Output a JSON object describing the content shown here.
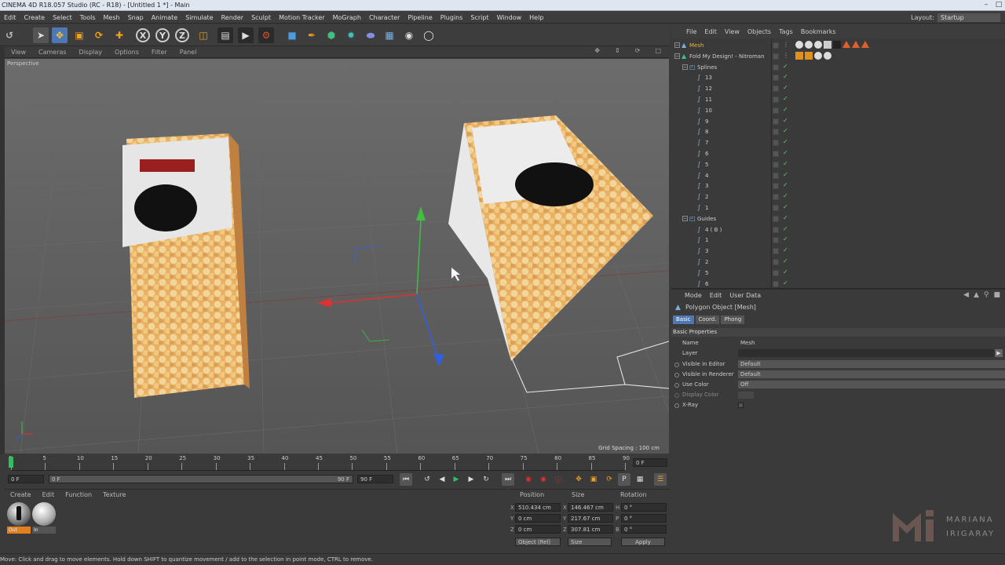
{
  "window": {
    "title": "CINEMA 4D R18.057 Studio (RC - R18) - [Untitled 1 *] - Main"
  },
  "menu": {
    "items": [
      "Edit",
      "Create",
      "Select",
      "Tools",
      "Mesh",
      "Snap",
      "Animate",
      "Simulate",
      "Render",
      "Sculpt",
      "Motion Tracker",
      "MoGraph",
      "Character",
      "Pipeline",
      "Plugins",
      "Script",
      "Window",
      "Help"
    ]
  },
  "layout": {
    "label": "Layout:",
    "value": "Startup"
  },
  "viewport": {
    "menu": [
      "View",
      "Cameras",
      "Display",
      "Options",
      "Filter",
      "Panel"
    ],
    "label": "Perspective",
    "grid_spacing": "Grid Spacing : 100 cm"
  },
  "toolbar": {
    "icons": [
      "undo-icon",
      "select-icon",
      "move-icon",
      "scale-icon",
      "rotate-icon",
      "add-icon",
      "x-axis-icon",
      "y-axis-icon",
      "z-axis-icon",
      "coordinate-system-icon",
      "render-view-icon",
      "render-picture-viewer-icon",
      "render-settings-icon",
      "cube-icon",
      "pen-icon",
      "subdivision-icon",
      "cloner-icon",
      "deformer-icon",
      "floor-icon",
      "camera-icon",
      "light-icon"
    ],
    "x_label": "X",
    "y_label": "Y",
    "z_label": "Z"
  },
  "timeline": {
    "ticks": [
      "0",
      "5",
      "10",
      "15",
      "20",
      "25",
      "30",
      "35",
      "40",
      "45",
      "50",
      "55",
      "60",
      "65",
      "70",
      "75",
      "80",
      "85",
      "90"
    ],
    "current_frame_display": "0 F",
    "current": 0,
    "max": 90,
    "start_frame": "0 F",
    "slider_left": "0 F",
    "slider_right": "90 F",
    "end_frame": "90 F"
  },
  "materials": {
    "menu": [
      "Create",
      "Edit",
      "Function",
      "Texture"
    ],
    "items": [
      {
        "label": "Out"
      },
      {
        "label": "In"
      }
    ]
  },
  "coordinates": {
    "headers": [
      "Position",
      "Size",
      "Rotation"
    ],
    "rows": [
      {
        "axis": "X",
        "pos": "510.434 cm",
        "size_axis": "X",
        "size": "146.467 cm",
        "rot_axis": "H",
        "rot": "0 °"
      },
      {
        "axis": "Y",
        "pos": "0 cm",
        "size_axis": "Y",
        "size": "217.67 cm",
        "rot_axis": "P",
        "rot": "0 °"
      },
      {
        "axis": "Z",
        "pos": "0 cm",
        "size_axis": "Z",
        "size": "307.81 cm",
        "rot_axis": "B",
        "rot": "0 °"
      }
    ],
    "mode": "Object (Rel)",
    "size_mode": "Size",
    "apply": "Apply"
  },
  "objects": {
    "menu": [
      "File",
      "Edit",
      "View",
      "Objects",
      "Tags",
      "Bookmarks"
    ],
    "rows": [
      {
        "name": "Mesh",
        "indent": 0,
        "highlight": true
      },
      {
        "name": "Fold My Design! - Nitroman",
        "indent": 0,
        "highlight": false
      },
      {
        "name": "Splines",
        "indent": 1,
        "highlight": false
      },
      {
        "name": "13",
        "indent": 2,
        "highlight": false
      },
      {
        "name": "12",
        "indent": 2,
        "highlight": false
      },
      {
        "name": "11",
        "indent": 2,
        "highlight": false
      },
      {
        "name": "10",
        "indent": 2,
        "highlight": false
      },
      {
        "name": "9",
        "indent": 2,
        "highlight": false
      },
      {
        "name": "8",
        "indent": 2,
        "highlight": false
      },
      {
        "name": "7",
        "indent": 2,
        "highlight": false
      },
      {
        "name": "6",
        "indent": 2,
        "highlight": false
      },
      {
        "name": "5",
        "indent": 2,
        "highlight": false
      },
      {
        "name": "4",
        "indent": 2,
        "highlight": false
      },
      {
        "name": "3",
        "indent": 2,
        "highlight": false
      },
      {
        "name": "2",
        "indent": 2,
        "highlight": false
      },
      {
        "name": "1",
        "indent": 2,
        "highlight": false
      },
      {
        "name": "Guides",
        "indent": 1,
        "highlight": false
      },
      {
        "name": "4 ( B )",
        "indent": 2,
        "highlight": false
      },
      {
        "name": "1",
        "indent": 2,
        "highlight": false
      },
      {
        "name": "3",
        "indent": 2,
        "highlight": false
      },
      {
        "name": "2",
        "indent": 2,
        "highlight": false
      },
      {
        "name": "5",
        "indent": 2,
        "highlight": false
      },
      {
        "name": "6",
        "indent": 2,
        "highlight": false
      }
    ]
  },
  "attributes": {
    "menu": [
      "Mode",
      "Edit",
      "User Data"
    ],
    "title": "Polygon Object [Mesh]",
    "tabs": [
      "Basic",
      "Coord.",
      "Phong"
    ],
    "section": "Basic Properties",
    "props": [
      {
        "label": "Name",
        "value": "Mesh"
      },
      {
        "label": "Layer",
        "value": ""
      },
      {
        "label": "Visible in Editor",
        "value": "Default"
      },
      {
        "label": "Visible in Renderer",
        "value": "Default"
      },
      {
        "label": "Use Color",
        "value": "Off"
      },
      {
        "label": "Display Color",
        "value": ""
      },
      {
        "label": "X-Ray",
        "value": ""
      }
    ]
  },
  "status": {
    "text": "Move: Click and drag to move elements. Hold down SHIFT to quantize movement / add to the selection in point mode, CTRL to remove."
  },
  "watermark": {
    "line1": "MARIANA",
    "line2": "IRIGARAY"
  }
}
